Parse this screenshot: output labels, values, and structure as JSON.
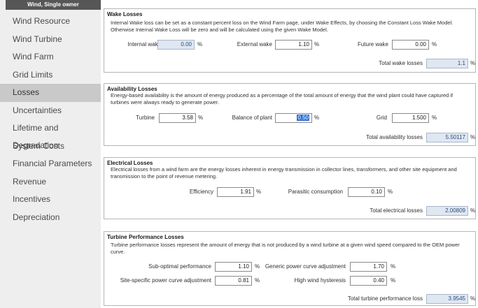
{
  "sidebar": {
    "header": "Wind, Single owner",
    "items": [
      {
        "label": "Wind Resource"
      },
      {
        "label": "Wind Turbine"
      },
      {
        "label": "Wind Farm"
      },
      {
        "label": "Grid Limits"
      },
      {
        "label": "Losses",
        "active": true
      },
      {
        "label": "Uncertainties"
      },
      {
        "label": "Lifetime and Degradation"
      },
      {
        "label": "System Costs"
      },
      {
        "label": "Financial Parameters"
      },
      {
        "label": "Revenue"
      },
      {
        "label": "Incentives"
      },
      {
        "label": "Depreciation"
      }
    ]
  },
  "wake": {
    "title": "Wake Losses",
    "desc": "Internal Wake loss can be set as a constant percent loss on the Wind Farm page, under Wake Effects, by choosing the Constant Loss Wake Model. Otherwise Internal Wake Loss will be zero and will be calculated using the given Wake Model.",
    "internal_label": "Internal wake",
    "internal_value": "0.00",
    "external_label": "External wake",
    "external_value": "1.10",
    "future_label": "Future wake",
    "future_value": "0.00",
    "total_label": "Total wake losses",
    "total_value": "1.1",
    "unit": "%"
  },
  "availability": {
    "title": "Availability Losses",
    "desc": "Energy-based availability is the amount of energy produced as a percentage of the total amount of energy that the wind plant could have captured if turbines were always ready to generate power.",
    "turbine_label": "Turbine",
    "turbine_value": "3.58",
    "bop_label": "Balance of plant",
    "bop_value": "0.50",
    "grid_label": "Grid",
    "grid_value": "1.500",
    "total_label": "Total availability losses",
    "total_value": "5.50117",
    "unit": "%"
  },
  "electrical": {
    "title": "Electrical Losses",
    "desc": "Electrical losses from a wind farm are the energy losses inherent in energy transmission in collector lines, transformers, and other site equipment and transmission to the point of revenue metering.",
    "efficiency_label": "Efficiency",
    "efficiency_value": "1.91",
    "parasitic_label": "Parasitic consumption",
    "parasitic_value": "0.10",
    "total_label": "Total electrical losses",
    "total_value": "2.00809",
    "unit": "%"
  },
  "turbine_perf": {
    "title": "Turbine Performance Losses",
    "desc": "Turbine performance losses represent the amount of energy that is not produced by a wind turbine at a given wind speed compared to the OEM power curve.",
    "subopt_label": "Sub-optimal performance",
    "subopt_value": "1.10",
    "generic_label": "Generic power curve adjustment",
    "generic_value": "1.70",
    "sitespec_label": "Site-specific power curve adjustment",
    "sitespec_value": "0.81",
    "hyst_label": "High wind hysteresis",
    "hyst_value": "0.40",
    "total_label": "Total turbine performance loss",
    "total_value": "3.9545",
    "unit": "%"
  }
}
